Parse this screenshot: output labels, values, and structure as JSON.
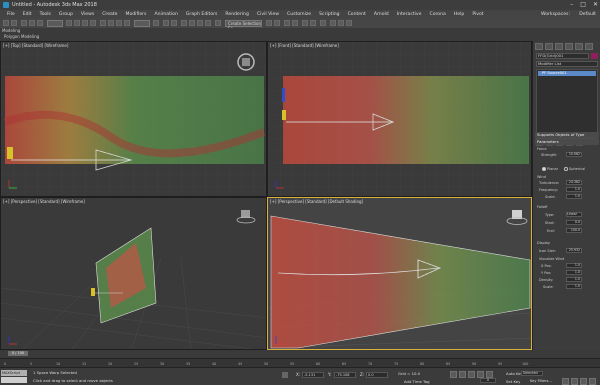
{
  "window": {
    "title": "Untitled - Autodesk 3ds Max 2018",
    "buttons": [
      "–",
      "□",
      "✕"
    ]
  },
  "menu": {
    "items": [
      "File",
      "Edit",
      "Tools",
      "Group",
      "Views",
      "Create",
      "Modifiers",
      "Animation",
      "Graph Editors",
      "Rendering",
      "Civil View",
      "Customize",
      "Scripting",
      "Content",
      "Arnold",
      "Interactive",
      "Corona",
      "Help",
      "Pivot"
    ],
    "workspaces_label": "Workspaces:",
    "workspaces_value": "Default"
  },
  "toolbar": {
    "selection_set": "Create Selection Se"
  },
  "ribbon": {
    "tab1": "Modeling",
    "tab2": "Polygon Modeling"
  },
  "viewports": {
    "top": "[+] [Top] [Standard] [Wireframe]",
    "front": "[+] [Front] [Standard] [Wireframe]",
    "left": "[+] [Perspective] [Standard] [Wireframe]",
    "perspective": "[+] [Perspective] [Standard] [Default Shading]"
  },
  "command_panel": {
    "object_name": "FFD(Grid)001",
    "modifier_list": "Modifier List",
    "stack_item": "PF Source001",
    "rollout_supports": "Supports Objects of Type",
    "rollout_params": "Parameters",
    "force_label": "Force",
    "strength_label": "Strength:",
    "strength_value": "10.062",
    "planar_label": "Planar",
    "spherical_label": "Spherical",
    "wind_label": "Wind",
    "turbulence_label": "Turbulence:",
    "turbulence_value": "24.362",
    "frequency_label": "Frequency:",
    "frequency_value": "1.0",
    "scale_label": "Scale:",
    "scale_value": "1.0",
    "falloff_label": "Falloff",
    "type_label": "Type:",
    "type_value": "Linear",
    "start_label": "Start:",
    "start_value": "0.0",
    "end_label": "End:",
    "end_value": "100.0",
    "display_label": "Display",
    "icon_size_label": "Icon Size:",
    "icon_size_value": "25.932",
    "visualize_label": "Visualize Wind",
    "xpos_label": "X Pos:",
    "xpos_value": "1.0",
    "ypos_label": "Y Pos:",
    "ypos_value": "1.0",
    "density_label": "Density:",
    "density_value": "1.0",
    "scale2_label": "Scale:",
    "scale2_value": "1.0"
  },
  "timeline": {
    "slider": "0 / 100",
    "ticks": [
      "0",
      "5",
      "10",
      "15",
      "20",
      "25",
      "30",
      "35",
      "40",
      "45",
      "50",
      "55",
      "60",
      "65",
      "70",
      "75",
      "80",
      "85",
      "90",
      "95",
      "100"
    ]
  },
  "status": {
    "maxscript": "MAXScript Mini",
    "selected": "1 Space Warp Selected",
    "prompt": "Click and drag to select and move objects",
    "x_label": "X:",
    "x_value": "-5.131",
    "y_label": "Y:",
    "y_value": "-75.108",
    "z_label": "Z:",
    "z_value": "0.0",
    "grid": "Grid = 10.0",
    "add_time_tag": "Add Time Tag",
    "auto_key": "Auto Key",
    "selected_value": "Selected",
    "set_key": "Set Key",
    "key_filters": "Key Filters...",
    "frame_value": "0"
  }
}
